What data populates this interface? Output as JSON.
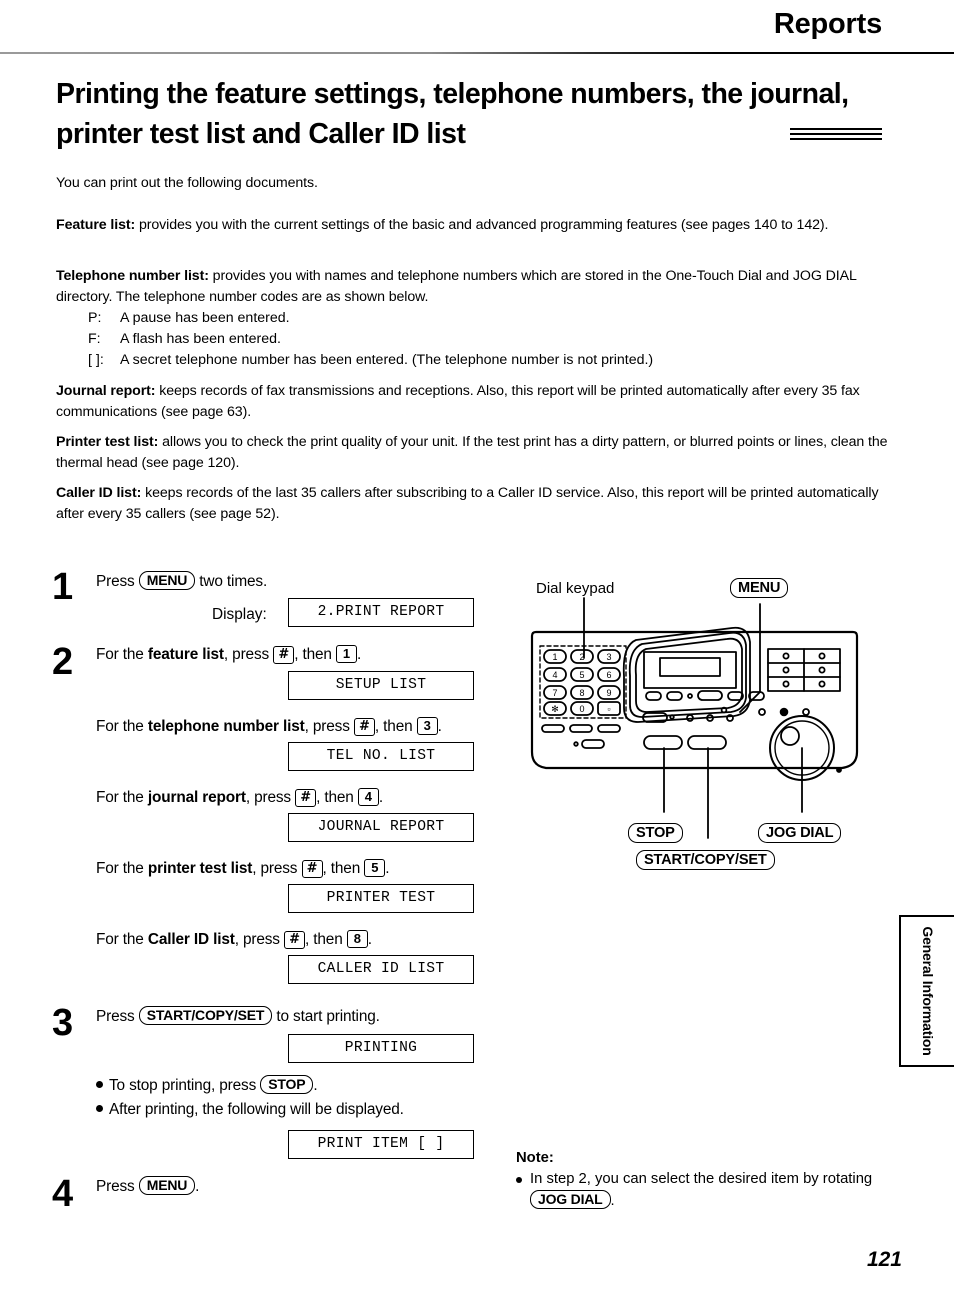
{
  "header": {
    "title": "Reports"
  },
  "section": {
    "title": "Printing the feature settings, telephone numbers, the journal, printer test list and Caller ID list"
  },
  "intro": "You can print out the following documents.",
  "paragraphs": [
    {
      "term": "Feature list:",
      "text": " provides you with the current settings of the basic and advanced programming features (see pages 140 to 142)."
    },
    {
      "term": "Telephone number list:",
      "text": " provides you with names and telephone numbers which are stored in the One-Touch Dial and JOG DIAL directory. The telephone number codes are as shown below."
    },
    {
      "term": "Journal report:",
      "text": " keeps records of fax transmissions and receptions. Also, this report will be printed automatically after every 35 fax communications (see page 63)."
    },
    {
      "term": "Printer test list:",
      "text": " allows you to check the print quality of your unit. If the test print has a dirty pattern, or blurred points or lines, clean the thermal head (see page 120)."
    },
    {
      "term": "Caller ID list:",
      "text": " keeps records of the last 35 callers after subscribing to a Caller ID service. Also, this report will be printed automatically after every 35 callers (see page 52)."
    }
  ],
  "code_legend": [
    {
      "symbol": "P:",
      "text": "A pause has been entered."
    },
    {
      "symbol": "F:",
      "text": "A flash has been entered."
    },
    {
      "symbol": "[  ]:",
      "text": "A secret telephone number has been entered. (The telephone number is not printed.)"
    }
  ],
  "steps": {
    "step1": {
      "number": "1",
      "text_before": "Press",
      "key": "MENU",
      "text_after": "two times.",
      "display_label": "Display:",
      "lcd": "2.PRINT REPORT"
    },
    "step2": {
      "number": "2",
      "items": [
        {
          "prefix": "For the",
          "bold": "feature list",
          "mid": ", press",
          "key1": "#",
          "mid2": ", then",
          "key2": "1",
          "suffix": ".",
          "lcd": "SETUP LIST"
        },
        {
          "prefix": "For the",
          "bold": "telephone number list",
          "mid": ", press",
          "key1": "#",
          "mid2": ", then",
          "key2": "3",
          "suffix": ".",
          "lcd": "TEL NO. LIST"
        },
        {
          "prefix": "For the",
          "bold": "journal report",
          "mid": ", press",
          "key1": "#",
          "mid2": ", then",
          "key2": "4",
          "suffix": ".",
          "lcd": "JOURNAL REPORT"
        },
        {
          "prefix": "For the",
          "bold": "printer test list",
          "mid": ", press",
          "key1": "#",
          "mid2": ", then",
          "key2": "5",
          "suffix": ".",
          "lcd": "PRINTER TEST"
        },
        {
          "prefix": "For the",
          "bold": "Caller ID list",
          "mid": ", press",
          "key1": "#",
          "mid2": ", then",
          "key2": "8",
          "suffix": ".",
          "lcd": "CALLER ID LIST"
        }
      ]
    },
    "step3": {
      "number": "3",
      "text_before": "Press",
      "key": "START/COPY/SET",
      "text_after": "to start printing.",
      "lcd": "PRINTING",
      "bullet1_before": "To stop printing, press",
      "bullet1_key": "STOP",
      "bullet1_after": ".",
      "bullet2": "After printing, the following will be displayed.",
      "lcd2": "PRINT ITEM [  ]"
    },
    "step4": {
      "number": "4",
      "text_before": "Press",
      "key": "MENU",
      "text_after": "."
    }
  },
  "figure": {
    "callout_dial_keypad": "Dial keypad",
    "callout_menu": "MENU",
    "callout_stop": "STOP",
    "callout_start": "START/COPY/SET",
    "callout_jog": "JOG DIAL",
    "keypad_keys": [
      "1",
      "2",
      "3",
      "4",
      "5",
      "6",
      "7",
      "8",
      "9",
      "✻",
      "0",
      "#"
    ]
  },
  "note": {
    "title": "Note:",
    "bullet_before": "In step 2, you can select the desired item by rotating",
    "bullet_key": "JOG DIAL",
    "bullet_after": "."
  },
  "side_tab": {
    "label": "General Information"
  },
  "page_number": "121",
  "colors": {
    "ink": "#000000",
    "paper": "#ffffff"
  }
}
